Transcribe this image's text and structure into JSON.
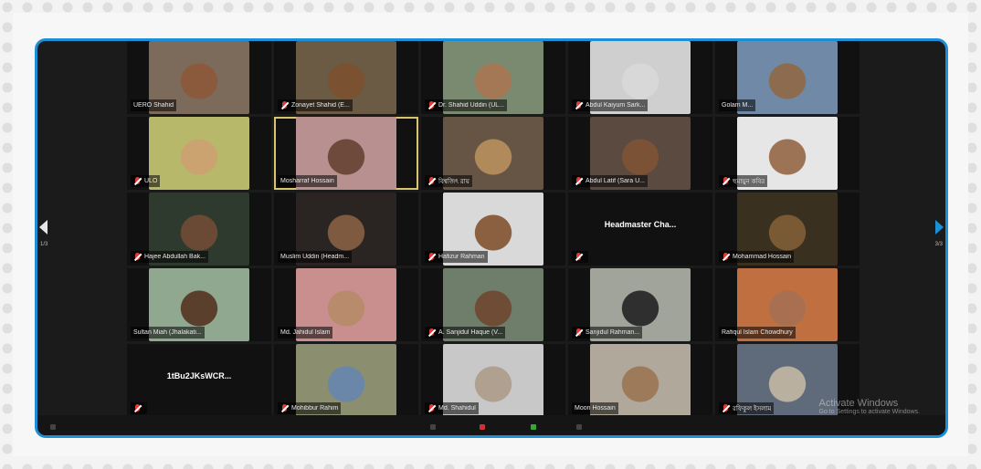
{
  "colors": {
    "frame_accent": "#1d8fd6",
    "active_speaker": "#d9c56b",
    "muted_icon": "#e53935"
  },
  "navigation": {
    "page_left": "1/3",
    "page_right": "3/3"
  },
  "watermark": {
    "line1": "Activate Windows",
    "line2": "Go to Settings to activate Windows."
  },
  "participants": [
    {
      "name": "UERO Shahid",
      "muted": false,
      "bg": "#7c6a5a",
      "face": "#8b5a3c"
    },
    {
      "name": "Zonayet Shahid (E...",
      "muted": true,
      "bg": "#6b5a44",
      "face": "#7a5131"
    },
    {
      "name": "Dr. Shahid Uddin (UL...",
      "muted": true,
      "bg": "#7a8a70",
      "face": "#a47855"
    },
    {
      "name": "Abdul Kaiyum Sark...",
      "muted": true,
      "bg": "#cfcfcf",
      "face": "#d8d8d8"
    },
    {
      "name": "Golam M...",
      "muted": false,
      "bg": "#6f89a6",
      "face": "#8d6b4f"
    },
    {
      "name": "ULO",
      "muted": true,
      "bg": "#b8b86a",
      "face": "#caa371"
    },
    {
      "name": "Mosharraf Hossain",
      "muted": false,
      "bg": "#b89090",
      "face": "#6d4a3b",
      "active": true
    },
    {
      "name": "বিশ্বজিৎ রায়",
      "muted": true,
      "bg": "#665544",
      "face": "#b08a5a"
    },
    {
      "name": "Abdul Latif (Sara U...",
      "muted": true,
      "bg": "#5a4a40",
      "face": "#7b5236"
    },
    {
      "name": "হুমায়ুন কবির",
      "muted": true,
      "bg": "#e6e6e6",
      "face": "#9c7455"
    },
    {
      "name": "Hajee Abdullah Bak...",
      "muted": true,
      "bg": "#2f3a2f",
      "face": "#6b4a35"
    },
    {
      "name": "Muslim Uddin (Headm...",
      "muted": false,
      "bg": "#2a2522",
      "face": "#7e5a40"
    },
    {
      "name": "Hafizur Rahman",
      "muted": true,
      "bg": "#d9d9d9",
      "face": "#8a6040"
    },
    {
      "name": "",
      "muted": true,
      "bg": "#111111",
      "face": "#111111",
      "label": "Headmaster Cha..."
    },
    {
      "name": "Mohammad Hossain",
      "muted": true,
      "bg": "#3a3020",
      "face": "#7a5a35"
    },
    {
      "name": "Sultan Miah (Jhalakati...",
      "muted": false,
      "bg": "#8fa88f",
      "face": "#5a3f2c"
    },
    {
      "name": "Md. Jahidul Islam",
      "muted": false,
      "bg": "#c98f8f",
      "face": "#b78b6b"
    },
    {
      "name": "A. Sanjidul Haque (V...",
      "muted": true,
      "bg": "#6f7e6a",
      "face": "#6e4c35"
    },
    {
      "name": "Sanjidul Rahman...",
      "muted": true,
      "bg": "#a0a49a",
      "face": "#2f2f2f"
    },
    {
      "name": "Rafiqul Islam Chowdhury",
      "muted": false,
      "bg": "#c07040",
      "face": "#a87050"
    },
    {
      "name": "",
      "muted": true,
      "bg": "#111111",
      "face": "#111111",
      "label": "1tBu2JKsWCR..."
    },
    {
      "name": "Mohibbur Rahim",
      "muted": true,
      "bg": "#8b8f6f",
      "face": "#6a86a8"
    },
    {
      "name": "Md. Shahidul",
      "muted": true,
      "bg": "#c8c8c8",
      "face": "#b0a090"
    },
    {
      "name": "Moon Hossain",
      "muted": false,
      "bg": "#b0a89a",
      "face": "#9c7a5a"
    },
    {
      "name": "রফিকুল ইসলাম",
      "muted": true,
      "bg": "#5f6a7a",
      "face": "#b9b0a0"
    }
  ]
}
